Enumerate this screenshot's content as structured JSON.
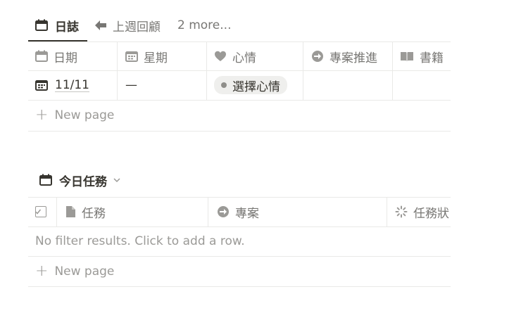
{
  "tabs": {
    "active": "日誌",
    "second": "上週回顧",
    "more": "2 more..."
  },
  "journal": {
    "columns": [
      "日期",
      "星期",
      "心情",
      "專案推進",
      "書籍"
    ],
    "row": {
      "date": "11/11",
      "weekday": "—",
      "mood": "選擇心情"
    },
    "new_page": "New page"
  },
  "tasks": {
    "title": "今日任務",
    "columns": [
      "任務",
      "專案",
      "任務狀"
    ],
    "empty": "No filter results. Click to add a row.",
    "new_page": "New page"
  }
}
